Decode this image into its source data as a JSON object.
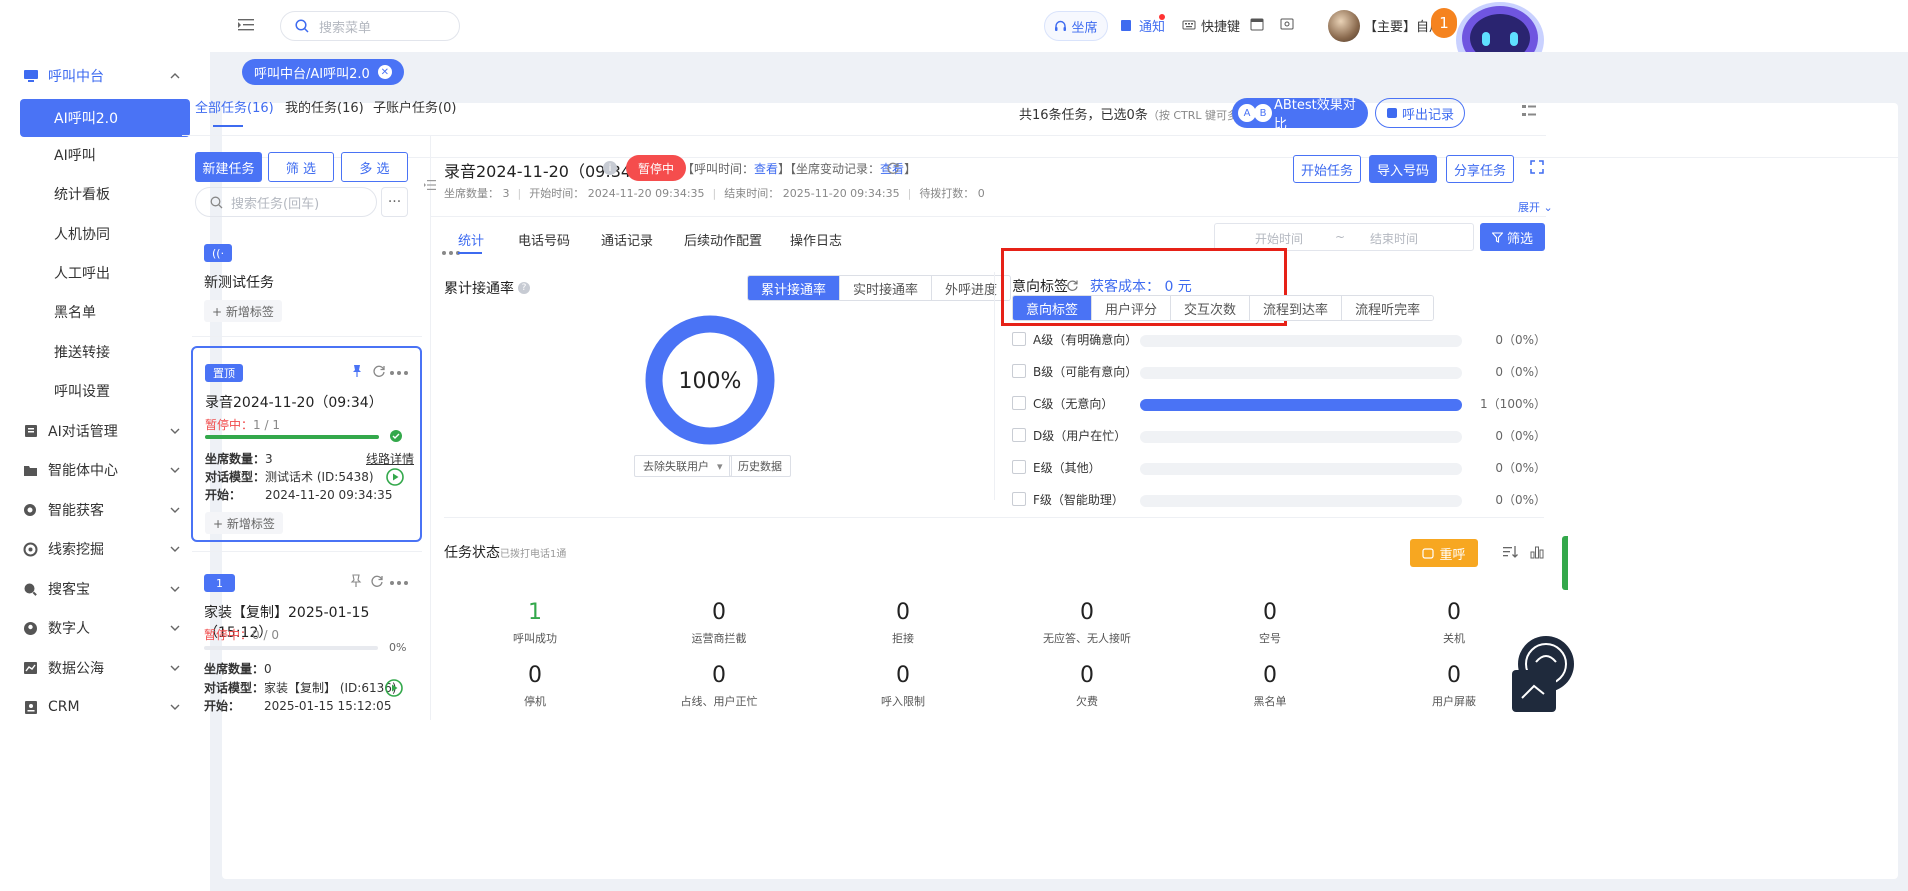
{
  "sidebar": {
    "groups": [
      {
        "label": "呼叫中台",
        "icon": "monitor-icon",
        "expanded": true
      },
      {
        "label": "AI对话管理",
        "icon": "book-icon"
      },
      {
        "label": "智能体中心",
        "icon": "folder-icon"
      },
      {
        "label": "智能获客",
        "icon": "target-search-icon"
      },
      {
        "label": "线索挖掘",
        "icon": "radar-icon"
      },
      {
        "label": "搜客宝",
        "icon": "magnifier-icon"
      },
      {
        "label": "数字人",
        "icon": "person-icon"
      },
      {
        "label": "数据公海",
        "icon": "chart-icon"
      },
      {
        "label": "CRM",
        "icon": "crm-icon"
      }
    ],
    "children": [
      "AI呼叫2.0",
      "AI呼叫",
      "统计看板",
      "人机协同",
      "人工呼出",
      "黑名单",
      "推送转接",
      "呼叫设置"
    ]
  },
  "header": {
    "search_placeholder": "搜索菜单",
    "seat": "坐席",
    "notify": "通知",
    "shortcut": "快捷键",
    "account": "【主要】自用",
    "badge": "1"
  },
  "breadcrumb": {
    "tag": "呼叫中台/AI呼叫2.0"
  },
  "tabs": {
    "all": "全部任务(16)",
    "mine": "我的任务(16)",
    "sub": "子账户任务(0)",
    "count_text": "共16条任务，已选0条",
    "count_hint": "（按 CTRL 键可多选）",
    "ab_letters": [
      "A",
      "B"
    ],
    "ab_label": "ABtest效果对比",
    "out_label": "呼出记录"
  },
  "tasklist": {
    "new_btn": "新建任务",
    "filter_btn": "筛 选",
    "multi_btn": "多 选",
    "search_placeholder": "搜索任务(回车)",
    "more": "···",
    "cards": [
      {
        "badge": "((·",
        "title": "新测试任务",
        "add_tag": "+ 新增标签"
      },
      {
        "badge": "置顶",
        "title": "录音2024-11-20（09:34）",
        "status": "暂停中：",
        "status_count": "1 / 1",
        "progress": 1.0,
        "seats_label": "坐席数量：",
        "seats": "3",
        "line_link": "线路详情",
        "model_label": "对话模型：",
        "model": "测试话术 (ID:5438)",
        "start_label": "开始：",
        "start": "2024-11-20 09:34:35",
        "add_tag": "+ 新增标签"
      },
      {
        "badge": "1",
        "title": "家装【复制】2025-01-15（15:12）",
        "status": "暂停中：",
        "status_count": "0 / 0",
        "progress": 0.0,
        "progress_text": "0%",
        "seats_label": "坐席数量：",
        "seats": "0",
        "model_label": "对话模型：",
        "model": "家装【复制】 (ID:6136)",
        "start_label": "开始：",
        "start": "2025-01-15 15:12:05"
      }
    ]
  },
  "detail": {
    "title": "录音2024-11-20（09:34）",
    "status": "暂停中",
    "call_time_label": "【呼叫时间：",
    "view": "查看",
    "seat_change_label": "】【坐席变动记录：",
    "close_bracket": "】",
    "meta": {
      "seats": "坐席数量：  3",
      "start": "开始时间：  2024-11-20 09:34:35",
      "end": "结束时间：  2025-11-20 09:34:35",
      "pending": "待拨打数：  0"
    },
    "btn_start": "开始任务",
    "btn_import": "导入号码",
    "btn_share": "分享任务",
    "unfold": "展开",
    "subtabs": [
      "统计",
      "电话号码",
      "通话记录",
      "后续动作配置",
      "操作日志"
    ],
    "date_start": "开始时间",
    "date_sep": "~",
    "date_end": "结束时间",
    "filter": "筛选",
    "rate_title": "累计接通率",
    "rate_tabs": [
      "累计接通率",
      "实时接通率",
      "外呼进度"
    ],
    "rate_value": 1.0,
    "rate_text": "100%",
    "exclude_sel": "去除失联用户",
    "history_btn": "历史数据",
    "intent_title": "意向标签",
    "acq_cost": "获客成本：  0 元",
    "intent_tabs": [
      "意向标签",
      "用户评分",
      "交互次数",
      "流程到达率",
      "流程听完率"
    ],
    "levels": [
      {
        "label": "A级（有明确意向）",
        "value": "0（0%）",
        "pct": 0
      },
      {
        "label": "B级（可能有意向）",
        "value": "0（0%）",
        "pct": 0
      },
      {
        "label": "C级（无意向）",
        "value": "1（100%）",
        "pct": 100
      },
      {
        "label": "D级（用户在忙）",
        "value": "0（0%）",
        "pct": 0
      },
      {
        "label": "E级（其他）",
        "value": "0（0%）",
        "pct": 0
      },
      {
        "label": "F级（智能助理）",
        "value": "0（0%）",
        "pct": 0
      }
    ],
    "task_status_title": "任务状态",
    "task_status_sub": "已拨打电话1通",
    "redial": "重呼",
    "stats": [
      {
        "num": "1",
        "label": "呼叫成功"
      },
      {
        "num": "0",
        "label": "运营商拦截"
      },
      {
        "num": "0",
        "label": "拒接"
      },
      {
        "num": "0",
        "label": "无应答、无人接听"
      },
      {
        "num": "0",
        "label": "空号"
      },
      {
        "num": "0",
        "label": "关机"
      },
      {
        "num": "0",
        "label": "停机"
      },
      {
        "num": "0",
        "label": "占线、用户正忙"
      },
      {
        "num": "0",
        "label": "呼入限制"
      },
      {
        "num": "0",
        "label": "欠费"
      },
      {
        "num": "0",
        "label": "黑名单"
      },
      {
        "num": "0",
        "label": "用户屏蔽"
      }
    ]
  },
  "colors": {
    "primary": "#4a73f5",
    "danger": "#f54d4d",
    "success": "#33a84b",
    "warning": "#f7a721",
    "highlight": "#e62117"
  }
}
